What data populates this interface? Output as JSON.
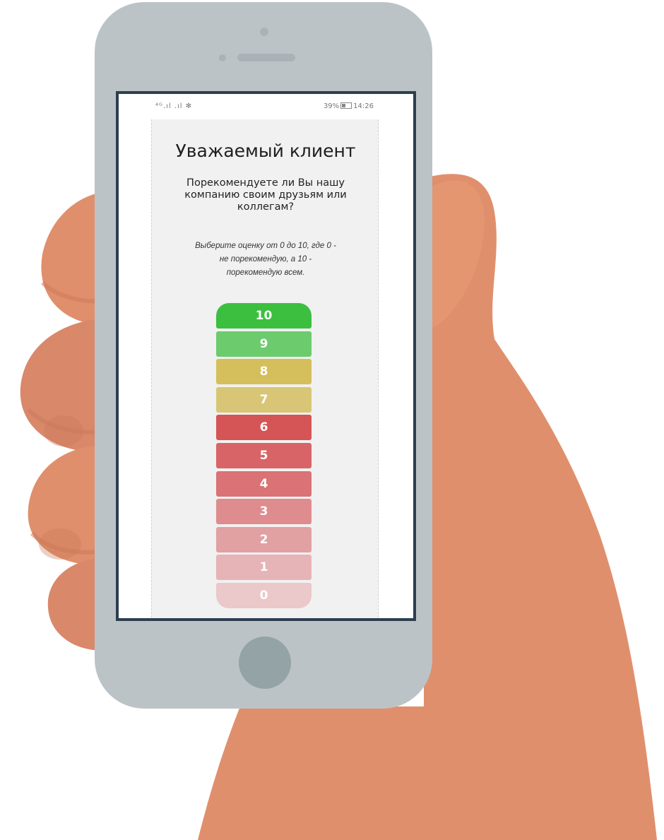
{
  "status_bar": {
    "signal": "⁴ᴳ.ıl .ıl ✻",
    "battery": "39%",
    "time": "14:26"
  },
  "survey": {
    "greeting": "Уважаемый клиент",
    "question": "Порекомендуете ли Вы нашу компанию своим друзьям или коллегам?",
    "instruction": "Выберите оценку от 0 до 10, где 0 - не порекомендую, а 10 - порекомендую всем.",
    "scores": [
      {
        "label": "10",
        "color": "#3cbf3f"
      },
      {
        "label": "9",
        "color": "#6ccb6c"
      },
      {
        "label": "8",
        "color": "#d4bf5c"
      },
      {
        "label": "7",
        "color": "#d8c676"
      },
      {
        "label": "6",
        "color": "#d55556"
      },
      {
        "label": "5",
        "color": "#d86467"
      },
      {
        "label": "4",
        "color": "#da7276"
      },
      {
        "label": "3",
        "color": "#de8c8e"
      },
      {
        "label": "2",
        "color": "#e1a0a2"
      },
      {
        "label": "1",
        "color": "#e6b4b6"
      },
      {
        "label": "0",
        "color": "#ebc8c9"
      }
    ]
  },
  "colors": {
    "skin": "#e08f6c",
    "skin_shadow": "#c9775a",
    "phone_body": "#bcc3c7",
    "screen_border": "#2c3e50",
    "home_button": "#93a3a6"
  }
}
